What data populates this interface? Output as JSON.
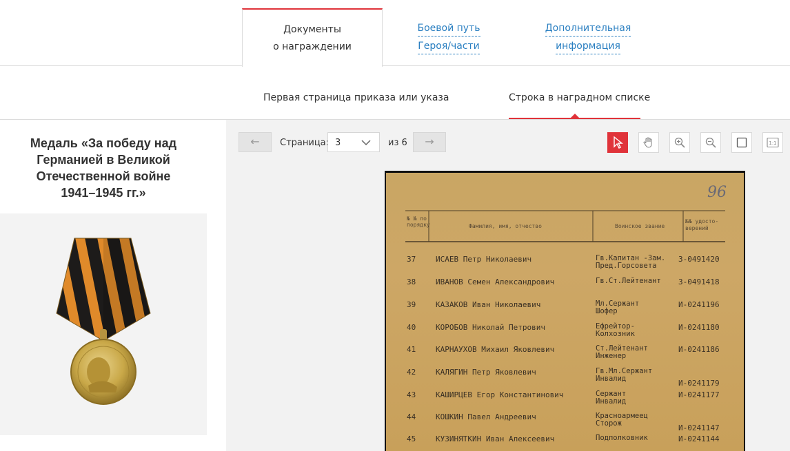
{
  "top_tabs": [
    {
      "line1": "Документы",
      "line2": "о награждении"
    },
    {
      "line1": "Боевой путь",
      "line2": "Героя/части"
    },
    {
      "line1": "Дополнительная",
      "line2": "информация"
    }
  ],
  "sub_tabs": [
    "Первая страница приказа или указа",
    "Строка в наградном списке"
  ],
  "award": {
    "title_lines": [
      "Медаль «За победу над",
      "Германией в Великой",
      "Отечественной войне",
      "1941–1945 гг.»"
    ]
  },
  "viewer": {
    "prev": "←",
    "next": "→",
    "page_label": "Страница:",
    "page_value": "3",
    "of_label": "из 6",
    "tools": [
      "pointer-icon",
      "hand-icon",
      "zoom-in-icon",
      "zoom-out-icon",
      "fit-page-icon",
      "actual-size-icon"
    ],
    "accent_color": "#e0333a"
  },
  "document": {
    "page_number": "96",
    "headers": {
      "num": "№ № по порядку",
      "name": "Фамилия, имя, отчество",
      "rank": "Воинское звание",
      "cert": "№№ удосто- верений"
    },
    "rows": [
      {
        "n": "37",
        "name": "ИСАЕВ Петр Николаевич",
        "rank": "Гв.Капитан -Зам.\nПред.Горсовета",
        "cert": "З-0491420"
      },
      {
        "n": "38",
        "name": "ИВАНОВ Семен Александрович",
        "rank": "Гв.Ст.Лейтенант",
        "cert": "З-0491418"
      },
      {
        "n": "39",
        "name": "КАЗАКОВ Иван Николаевич",
        "rank": "Мл.Сержант\nШофер",
        "cert": "И-0241196"
      },
      {
        "n": "40",
        "name": "КОРОБОВ Николай Петрович",
        "rank": "Ефрейтор-\nКолхозник",
        "cert": "И-0241180"
      },
      {
        "n": "41",
        "name": "КАРНАУХОВ Михаил Яковлевич",
        "rank": "Ст.Лейтенант\nИнженер",
        "cert": "И-0241186"
      },
      {
        "n": "42",
        "name": "КАЛЯГИН Петр Яковлевич",
        "rank": "Гв.Мл.Сержант\nИнвалид",
        "cert": "И-0241179"
      },
      {
        "n": "43",
        "name": "КАШИРЦЕВ Егор Константинович",
        "rank": "Сержант\nИнвалид",
        "cert": "И-0241177"
      },
      {
        "n": "44",
        "name": "КОШКИН Павел Андреевич",
        "rank": "Красноармеец\nСторож",
        "cert": "И-0241147"
      },
      {
        "n": "45",
        "name": "КУЗИНЯТКИН Иван Алексеевич",
        "rank": "Подполковник",
        "cert": "И-0241144"
      }
    ]
  }
}
